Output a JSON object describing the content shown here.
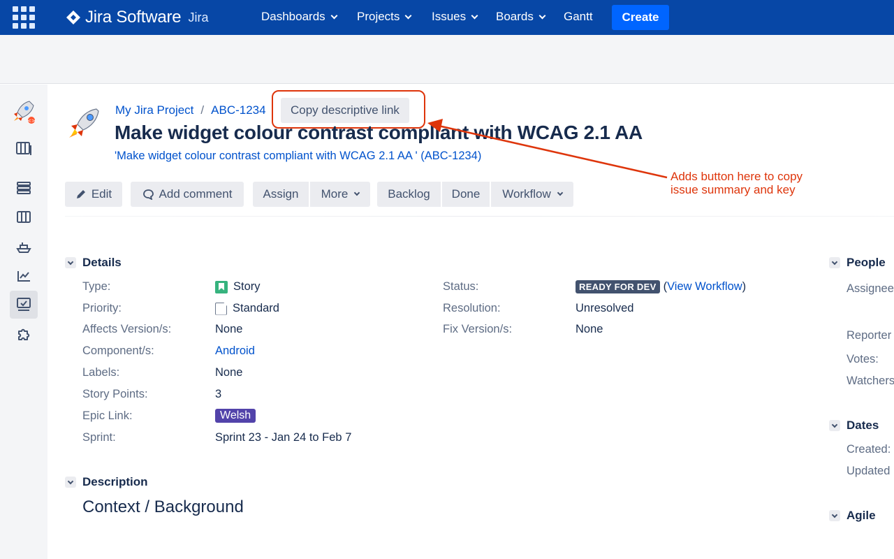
{
  "nav": {
    "brand": "Jira Software",
    "brand_sub": "Jira",
    "items": [
      {
        "label": "Dashboards"
      },
      {
        "label": "Projects"
      },
      {
        "label": "Issues"
      },
      {
        "label": "Boards"
      },
      {
        "label": "Gantt"
      }
    ],
    "create_label": "Create"
  },
  "sidebar": {
    "icons": [
      "project-rocket-icon",
      "backlog-board-icon",
      "stack-icon",
      "board-columns-icon",
      "releases-ship-icon",
      "reports-chart-icon",
      "issues-monitor-icon",
      "addons-puzzle-icon"
    ]
  },
  "issue": {
    "project": "My Jira Project",
    "breadcrumb_sep": "/",
    "key": "ABC-1234",
    "copy_link_label": "Copy descriptive link",
    "title": "Make widget colour contrast compliant with WCAG 2.1 AA",
    "descriptive_link": "'Make widget colour contrast compliant with WCAG 2.1 AA ' (ABC-1234)"
  },
  "annotation": {
    "line1": "Adds button here to copy",
    "line2": "issue summary and key",
    "color": "#de350b"
  },
  "toolbar": {
    "edit": "Edit",
    "add_comment": "Add comment",
    "assign": "Assign",
    "more": "More",
    "backlog": "Backlog",
    "done": "Done",
    "workflow": "Workflow"
  },
  "details": {
    "heading": "Details",
    "type_label": "Type:",
    "type_value": "Story",
    "priority_label": "Priority:",
    "priority_value": "Standard",
    "affects_label": "Affects Version/s:",
    "affects_value": "None",
    "component_label": "Component/s:",
    "component_value": "Android",
    "labels_label": "Labels:",
    "labels_value": "None",
    "points_label": "Story Points:",
    "points_value": "3",
    "epic_label": "Epic Link:",
    "epic_value": "Welsh",
    "sprint_label": "Sprint:",
    "sprint_value": "Sprint 23 - Jan 24 to Feb 7",
    "status_label": "Status:",
    "status_value": "READY FOR DEV",
    "view_workflow_open": "(",
    "view_workflow": "View Workflow",
    "view_workflow_close": ")",
    "resolution_label": "Resolution:",
    "resolution_value": "Unresolved",
    "fix_label": "Fix Version/s:",
    "fix_value": "None"
  },
  "description": {
    "heading": "Description",
    "subheading": "Context / Background"
  },
  "people": {
    "heading": "People",
    "assignee": "Assignee",
    "reporter": "Reporter",
    "votes": "Votes:",
    "watchers": "Watchers"
  },
  "dates": {
    "heading": "Dates",
    "created": "Created:",
    "updated": "Updated"
  },
  "agile": {
    "heading": "Agile"
  }
}
